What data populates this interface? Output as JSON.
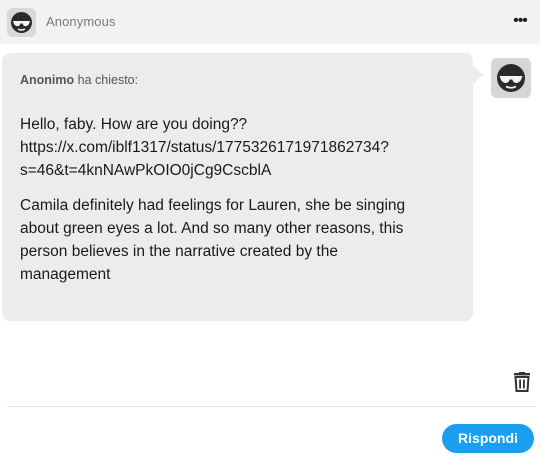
{
  "header": {
    "avatar_icon": "sunglasses-avatar-icon",
    "name": "Anonymous",
    "more_icon": "more-dots-icon",
    "more_label": "•••"
  },
  "ask": {
    "avatar_icon": "sunglasses-avatar-icon",
    "asker_name": "Anonimo",
    "asked_label": "ha chiesto:",
    "paragraphs": [
      "Hello, faby. How are you doing??\nhttps://x.com/iblf1317/status/1775326171971862734?\ns=46&t=4knNAwPkOIO0jCg9CscblA",
      "Camila definitely had feelings for Lauren, she be singing\nabout green eyes a lot. And so many other reasons, this\nperson believes in the narrative created by the\nmanagement"
    ]
  },
  "actions": {
    "delete_icon": "trash-icon",
    "reply_label": "Rispondi"
  },
  "colors": {
    "header_bg": "#f2f2f2",
    "bubble_bg": "#ececec",
    "accent": "#199ef0"
  }
}
